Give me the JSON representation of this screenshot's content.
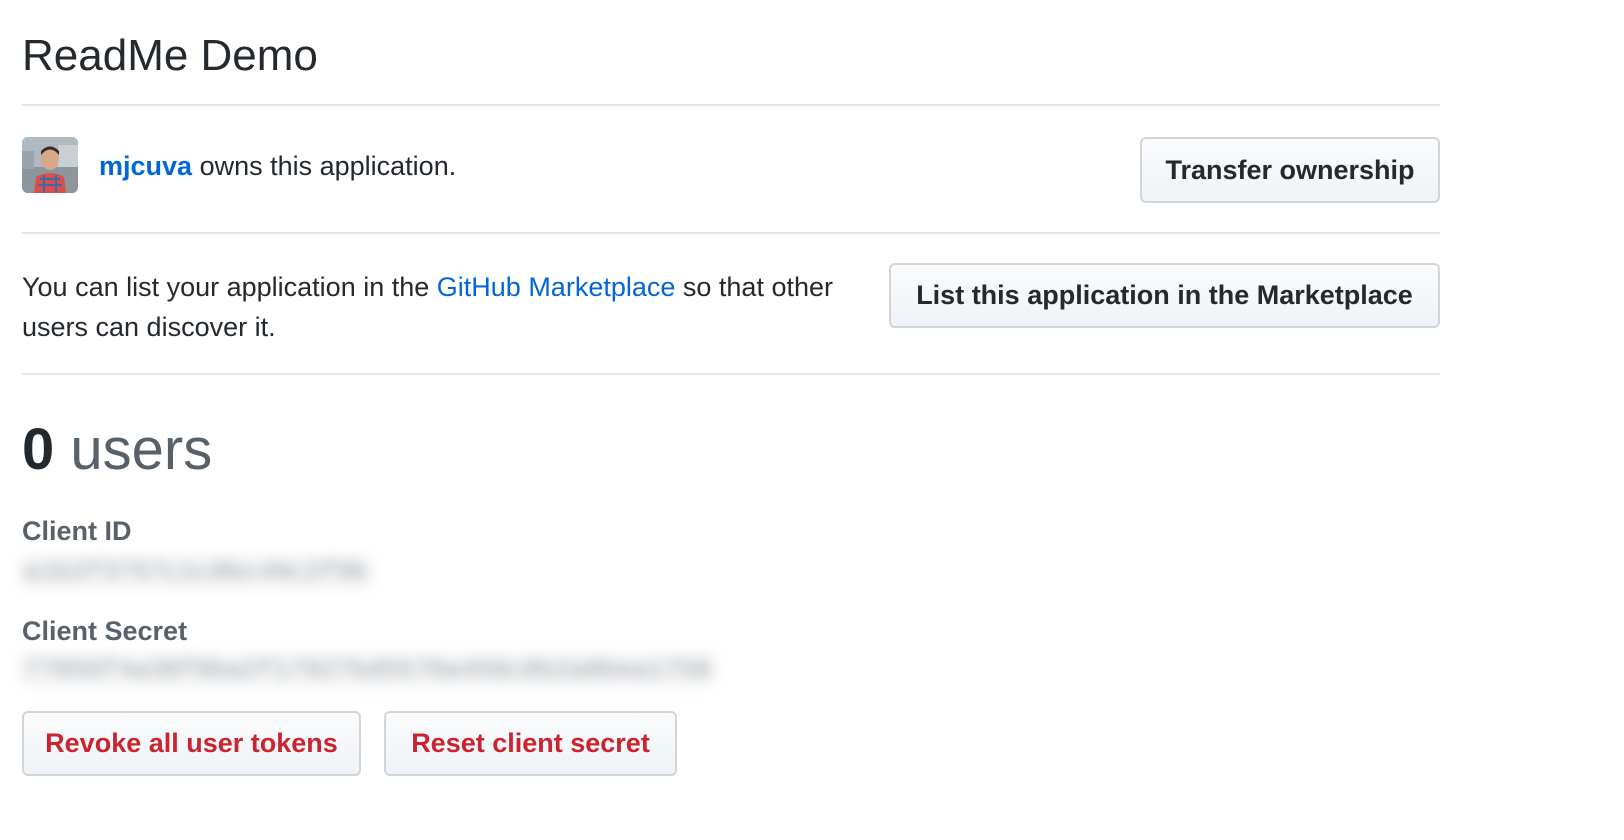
{
  "app": {
    "title": "ReadMe Demo"
  },
  "owner": {
    "username": "mjcuva",
    "suffix_text": " owns this application.",
    "transfer_button": "Transfer ownership"
  },
  "marketplace": {
    "text_before": "You can list your application in the ",
    "link_text": "GitHub Marketplace",
    "text_after": " so that other users can discover it.",
    "list_button": "List this application in the Marketplace"
  },
  "users": {
    "count": "0",
    "label": "users"
  },
  "credentials": {
    "client_id_label": "Client ID",
    "client_id_value": "a1b2f3757c1c8bc49c2f9b",
    "client_secret_label": "Client Secret",
    "client_secret_value": "77856f4a38f8ba2f17927bd5570a456c8b2a8bea1758"
  },
  "actions": {
    "revoke_button": "Revoke all user tokens",
    "reset_button": "Reset client secret"
  },
  "colors": {
    "link": "#0366d6",
    "danger": "#cb2431",
    "text": "#24292e",
    "muted": "#586069",
    "border": "#e1e4e8"
  }
}
